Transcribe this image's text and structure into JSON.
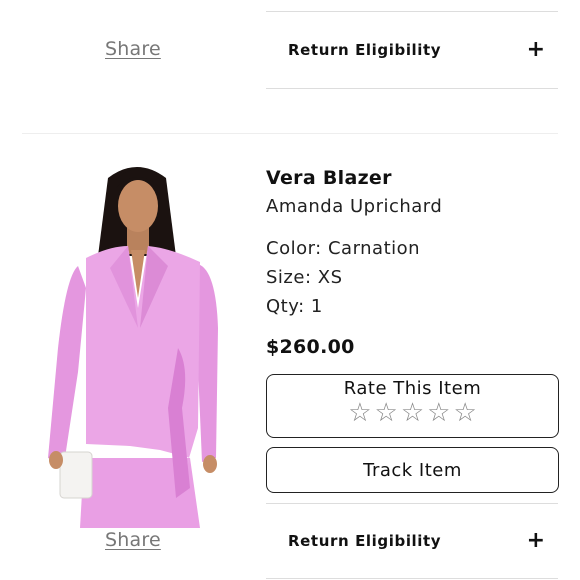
{
  "top_section": {
    "share_label": "Share",
    "return_label": "Return Eligibility",
    "expand_symbol": "+"
  },
  "product": {
    "title": "Vera Blazer",
    "brand": "Amanda Uprichard",
    "color": "Color: Carnation",
    "size": "Size: XS",
    "qty": "Qty: 1",
    "price": "$260.00",
    "image_icon": "product-photo-pink-blazer"
  },
  "rating": {
    "label": "Rate This Item",
    "star_symbol": "☆",
    "max_stars": 5,
    "current_rating": 0
  },
  "actions": {
    "track_label": "Track Item"
  },
  "bottom_section": {
    "share_label": "Share",
    "return_label": "Return Eligibility",
    "expand_symbol": "+"
  },
  "colors": {
    "blazer_pink": "#e99fe4",
    "text": "#111111",
    "muted_link": "#777777",
    "divider": "#dddddd"
  }
}
